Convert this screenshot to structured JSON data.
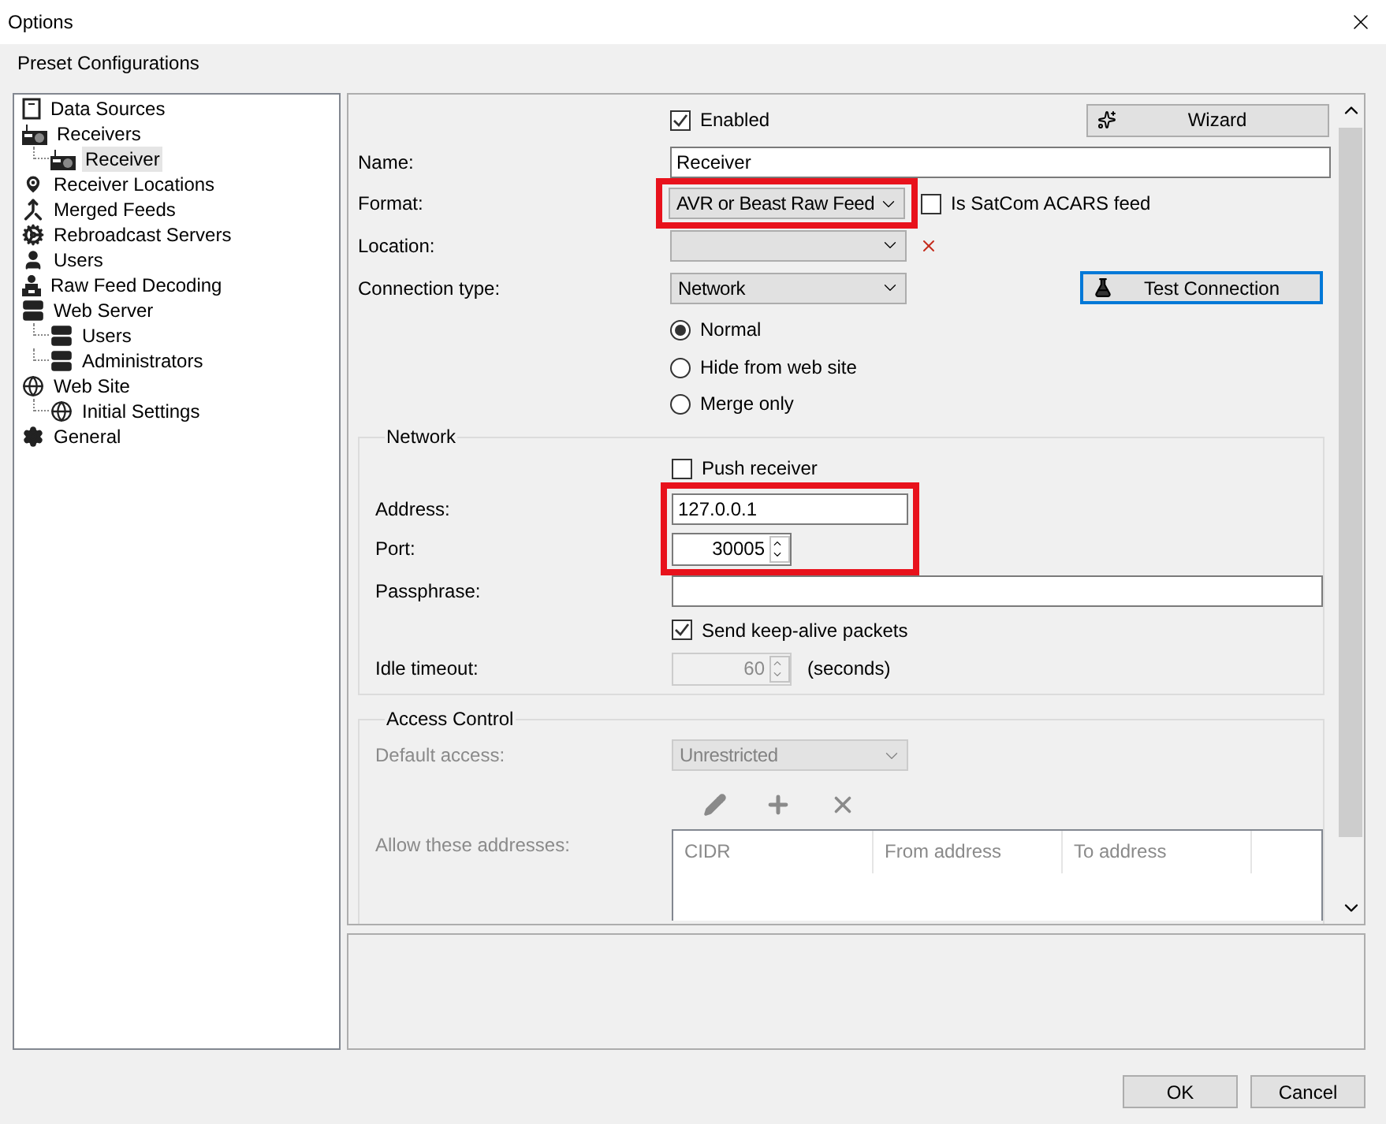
{
  "window": {
    "title": "Options"
  },
  "header": "Preset Configurations",
  "tree": [
    {
      "label": "Data Sources",
      "kind": "document",
      "selected": false
    },
    {
      "label": "Receivers",
      "kind": "radio",
      "selected": false,
      "children": [
        {
          "label": "Receiver",
          "kind": "radio",
          "selected": true
        }
      ]
    },
    {
      "label": "Receiver Locations",
      "kind": "pin",
      "selected": false
    },
    {
      "label": "Merged Feeds",
      "kind": "merge",
      "selected": false
    },
    {
      "label": "Rebroadcast Servers",
      "kind": "cog",
      "selected": false
    },
    {
      "label": "Users",
      "kind": "user",
      "selected": false
    },
    {
      "label": "Raw Feed Decoding",
      "kind": "decoder",
      "selected": false
    },
    {
      "label": "Web Server",
      "kind": "server",
      "selected": false,
      "children": [
        {
          "label": "Users",
          "kind": "server",
          "selected": false
        },
        {
          "label": "Administrators",
          "kind": "server",
          "selected": false
        }
      ]
    },
    {
      "label": "Web Site",
      "kind": "globe",
      "selected": false,
      "children": [
        {
          "label": "Initial Settings",
          "kind": "globe",
          "selected": false
        }
      ]
    },
    {
      "label": "General",
      "kind": "gear",
      "selected": false
    }
  ],
  "receiver": {
    "enabled": {
      "label": "Enabled",
      "checked": true
    },
    "wizard_button": "Wizard",
    "name": {
      "label": "Name:",
      "value": "Receiver"
    },
    "format": {
      "label": "Format:",
      "value": "AVR or Beast Raw Feed",
      "highlighted": true
    },
    "satcom": {
      "label": "Is SatCom ACARS feed",
      "checked": false
    },
    "location": {
      "label": "Location:"
    },
    "connection_type": {
      "label": "Connection type:",
      "value": "Network"
    },
    "test_button": "Test Connection",
    "modes": [
      {
        "label": "Normal",
        "selected": true
      },
      {
        "label": "Hide from web site",
        "selected": false
      },
      {
        "label": "Merge only",
        "selected": false
      }
    ]
  },
  "network": {
    "title": "Network",
    "highlighted": true,
    "push": {
      "label": "Push receiver",
      "checked": false
    },
    "address": {
      "label": "Address:",
      "value": "127.0.0.1"
    },
    "port": {
      "label": "Port:",
      "value": "30005"
    },
    "passphrase": {
      "label": "Passphrase:"
    },
    "keep_alive": {
      "label": "Send keep-alive packets",
      "checked": true
    },
    "idle_timeout": {
      "label": "Idle timeout:",
      "value": "60",
      "unit": "(seconds)",
      "disabled": true
    }
  },
  "access_control": {
    "title": "Access Control",
    "disabled": true,
    "default_access": {
      "label": "Default access:",
      "value": "Unrestricted"
    },
    "allow_label": "Allow these addresses:",
    "columns": [
      "CIDR",
      "From address",
      "To address"
    ]
  },
  "buttons": [
    {
      "label": "OK"
    },
    {
      "label": "Cancel"
    }
  ]
}
